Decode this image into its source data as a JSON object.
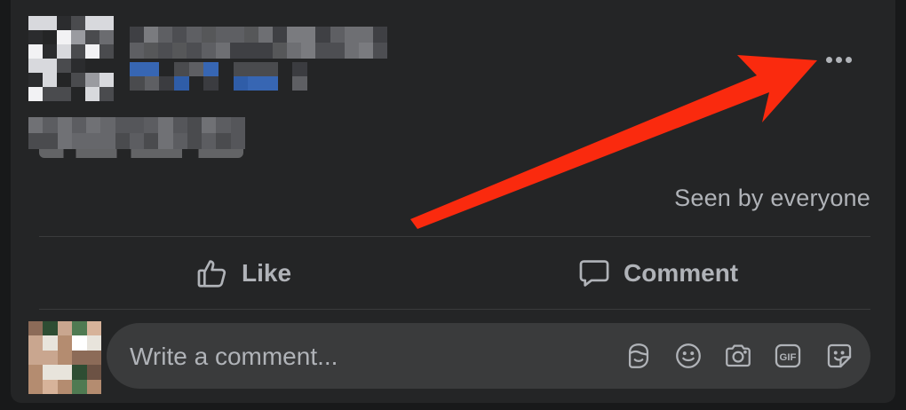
{
  "post": {
    "audience": "Seen by everyone",
    "more_options_icon": "more-horizontal-icon"
  },
  "actions": {
    "like_label": "Like",
    "comment_label": "Comment"
  },
  "comment_composer": {
    "placeholder": "Write a comment...",
    "icons": [
      "avatar-sticker-icon",
      "emoji-icon",
      "camera-icon",
      "gif-icon",
      "sticker-icon"
    ],
    "gif_label": "GIF"
  },
  "colors": {
    "card_bg": "#242526",
    "page_bg": "#18191a",
    "secondary_text": "#b0b3b8",
    "input_bg": "#3a3b3c",
    "annotation_arrow": "#fa2a0e"
  }
}
